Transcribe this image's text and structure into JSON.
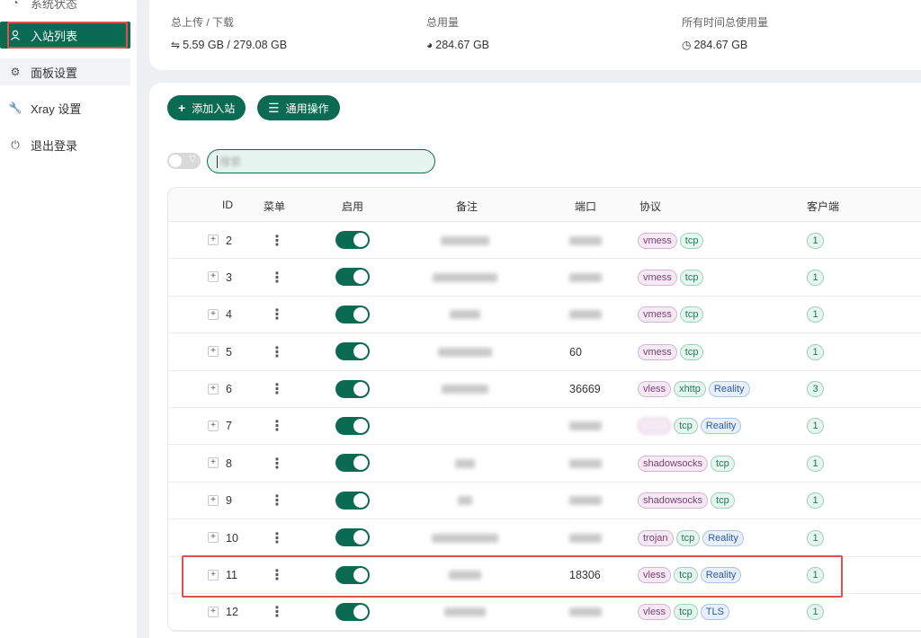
{
  "sidebar": {
    "items": [
      {
        "label": "系统状态",
        "icon": "dashboard-icon"
      },
      {
        "label": "入站列表",
        "icon": "user-icon"
      },
      {
        "label": "面板设置",
        "icon": "gear-icon"
      },
      {
        "label": "Xray 设置",
        "icon": "tool-icon"
      },
      {
        "label": "退出登录",
        "icon": "logout-icon"
      }
    ]
  },
  "stats": {
    "traffic_label": "总上传 / 下载",
    "traffic_value": "5.59 GB / 279.08 GB",
    "usage_label": "总用量",
    "usage_value": "284.67 GB",
    "alltime_label": "所有时间总使用量",
    "alltime_value": "284.67 GB"
  },
  "toolbar": {
    "add_label": "添加入站",
    "general_label": "通用操作",
    "search_placeholder": "搜索"
  },
  "table": {
    "headers": {
      "id": "ID",
      "menu": "菜单",
      "enable": "启用",
      "remark": "备注",
      "port": "端口",
      "protocol": "协议",
      "clients": "客户端"
    },
    "rows": [
      {
        "id": "2",
        "port": "",
        "tags": [
          [
            "vmess",
            "purple"
          ],
          [
            "tcp",
            "green"
          ]
        ],
        "clients": "1",
        "rw": 54,
        "pw": 36
      },
      {
        "id": "3",
        "port": "",
        "tags": [
          [
            "vmess",
            "purple"
          ],
          [
            "tcp",
            "green"
          ]
        ],
        "clients": "1",
        "rw": 72,
        "pw": 36
      },
      {
        "id": "4",
        "port": "",
        "tags": [
          [
            "vmess",
            "purple"
          ],
          [
            "tcp",
            "green"
          ]
        ],
        "clients": "1",
        "rw": 34,
        "pw": 36
      },
      {
        "id": "5",
        "port": "60",
        "tags": [
          [
            "vmess",
            "purple"
          ],
          [
            "tcp",
            "green"
          ]
        ],
        "clients": "1",
        "rw": 60,
        "pw": 0
      },
      {
        "id": "6",
        "port": "36669",
        "tags": [
          [
            "vless",
            "purple"
          ],
          [
            "xhttp",
            "green"
          ],
          [
            "Reality",
            "blue"
          ]
        ],
        "clients": "3",
        "rw": 52,
        "pw": 0
      },
      {
        "id": "7",
        "port": "",
        "tags": [
          [
            "vless",
            "purple"
          ],
          [
            "tcp",
            "green"
          ],
          [
            "Reality",
            "blue"
          ]
        ],
        "clients": "1",
        "rw": 0,
        "pw": 36,
        "blurfirst": true
      },
      {
        "id": "8",
        "port": "",
        "tags": [
          [
            "shadowsocks",
            "purple"
          ],
          [
            "tcp",
            "green"
          ]
        ],
        "clients": "1",
        "rw": 22,
        "pw": 36
      },
      {
        "id": "9",
        "port": "",
        "tags": [
          [
            "shadowsocks",
            "purple"
          ],
          [
            "tcp",
            "green"
          ]
        ],
        "clients": "1",
        "rw": 16,
        "pw": 36
      },
      {
        "id": "10",
        "port": "",
        "tags": [
          [
            "trojan",
            "purple"
          ],
          [
            "tcp",
            "green"
          ],
          [
            "Reality",
            "blue"
          ]
        ],
        "clients": "1",
        "rw": 74,
        "pw": 36
      },
      {
        "id": "11",
        "port": "18306",
        "tags": [
          [
            "vless",
            "purple"
          ],
          [
            "tcp",
            "green"
          ],
          [
            "Reality",
            "blue"
          ]
        ],
        "clients": "1",
        "rw": 36,
        "pw": 0
      },
      {
        "id": "12",
        "port": "",
        "tags": [
          [
            "vless",
            "purple"
          ],
          [
            "tcp",
            "green"
          ],
          [
            "TLS",
            "blue"
          ]
        ],
        "clients": "1",
        "rw": 46,
        "pw": 36
      }
    ]
  }
}
